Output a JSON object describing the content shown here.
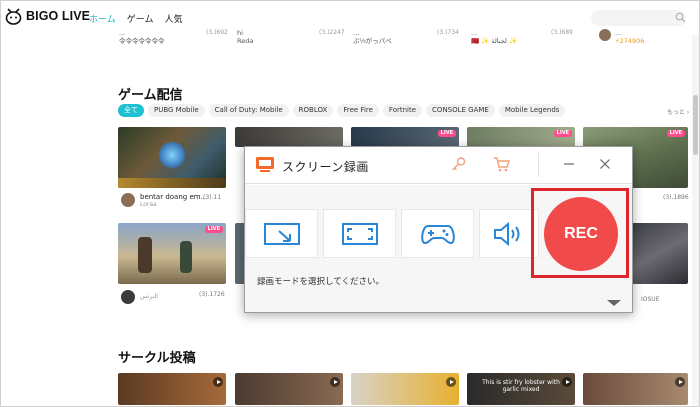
{
  "header": {
    "logo_text": "BIGO LIVE",
    "nav": [
      "ホーム",
      "ゲーム",
      "人気"
    ]
  },
  "top_row": {
    "items": [
      {
        "name": "...",
        "sub": "令令令令令令令",
        "count": "(3.)692"
      },
      {
        "name": "hi",
        "sub": "Reda",
        "count": "(3.)2247"
      },
      {
        "name": "...",
        "sub": "ぷ⅓がっパペ",
        "count": "(3.)734"
      },
      {
        "name": "...",
        "sub": "🇲🇦 ✨ لجبالة ✨",
        "count": "(3.)689"
      },
      {
        "name": "...",
        "sub": "⚡274906",
        "count": ""
      }
    ]
  },
  "game_section": {
    "title": "ゲーム配信",
    "chips": [
      "全て",
      "PUBG Mobile",
      "Call of Duty: Mobile",
      "ROBLOX",
      "Free Fire",
      "Fortnite",
      "CONSOLE GAME",
      "Mobile Legends"
    ],
    "more": "もっと ›",
    "live_badge": "LIVE",
    "streams": [
      {
        "name": "bentar doang em...",
        "user": "Loraa",
        "count": "(3).11"
      },
      {
        "name": "",
        "user": "",
        "count": "(3).1896"
      },
      {
        "name": "",
        "user": "البرنس",
        "count": "(3).1726"
      },
      {
        "name": "",
        "user": "IOSUE",
        "count": ""
      }
    ]
  },
  "circle_section": {
    "title": "サークル投稿",
    "caption": "This is stir fry lobster with garlic mixed"
  },
  "recorder": {
    "title": "スクリーン録画",
    "rec_label": "REC",
    "instruction": "録画モードを選択してください。",
    "modes": [
      "region-capture",
      "fullscreen-capture",
      "game-capture",
      "audio-capture"
    ],
    "accent": "#2a86d6",
    "rec_color": "#f14a4a"
  }
}
